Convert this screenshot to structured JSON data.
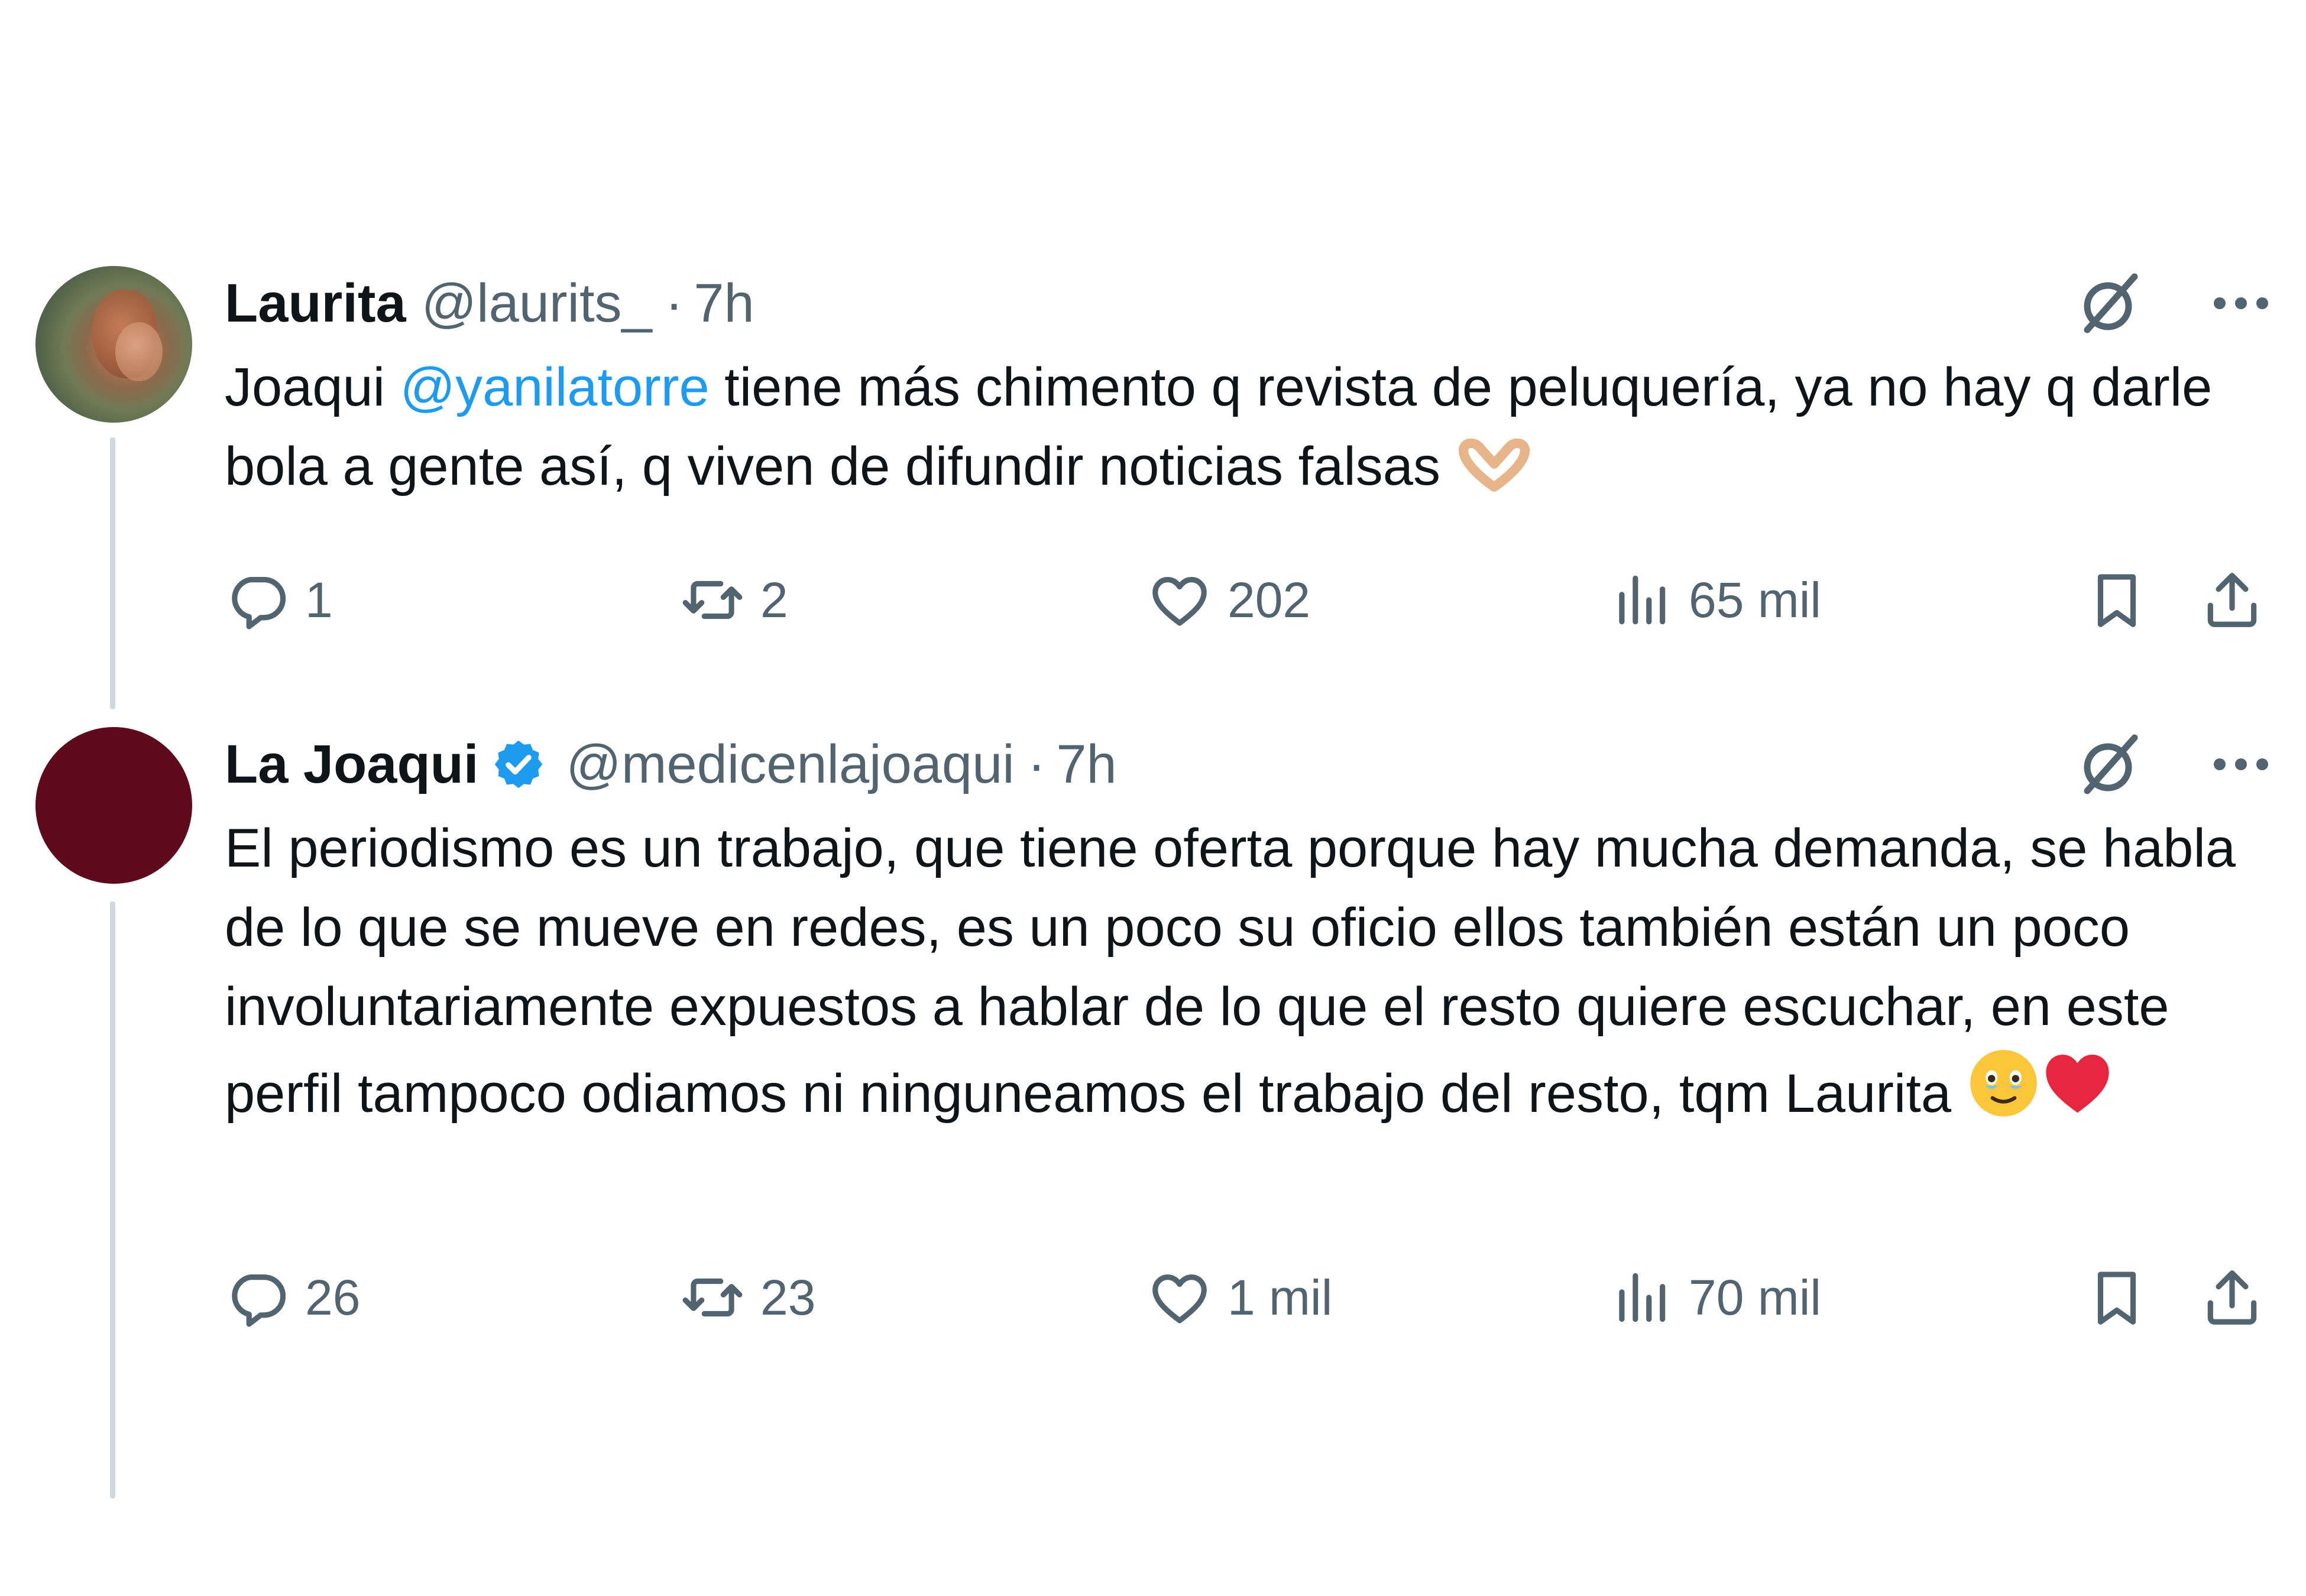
{
  "tweets": [
    {
      "author_name": "Laurita",
      "handle": "@laurits_",
      "separator": "·",
      "time": "7h",
      "verified": false,
      "text_parts": {
        "before_mention": "Joaqui ",
        "mention": "@yanilatorre",
        "after_mention": " tiene más chimento q revista de peluquería, ya no hay q darle bola a gente así, q viven de difundir noticias falsas "
      },
      "emojis": [
        "heart-hands-emoji"
      ],
      "stats": {
        "replies": "1",
        "reposts": "2",
        "likes": "202",
        "views": "65 mil"
      }
    },
    {
      "author_name": "La Joaqui",
      "handle": "@medicenlajoaqui",
      "separator": "·",
      "time": "7h",
      "verified": true,
      "text": "El periodismo es un trabajo, que tiene oferta porque hay mucha demanda, se habla de lo que se mueve en redes, es un poco su oficio ellos también están un poco involuntariamente expuestos a hablar de lo que el resto quiere escuchar, en este perfil tampoco odiamos ni ninguneamos el trabajo del resto, tqm Laurita ",
      "emojis": [
        "teary-smile-emoji",
        "red-heart-emoji"
      ],
      "stats": {
        "replies": "26",
        "reposts": "23",
        "likes": "1 mil",
        "views": "70 mil"
      }
    }
  ],
  "colors": {
    "text": "#0f1419",
    "secondary": "#536471",
    "link": "#1d9bf0",
    "verified_badge": "#1d9bf0",
    "thread_line": "#cfd9de",
    "avatar_2": "#5e0a1c"
  },
  "icons": {
    "header": [
      "grok-icon",
      "more-options-icon"
    ],
    "actions": [
      "reply-icon",
      "repost-icon",
      "like-icon",
      "views-icon",
      "bookmark-icon",
      "share-icon"
    ]
  }
}
